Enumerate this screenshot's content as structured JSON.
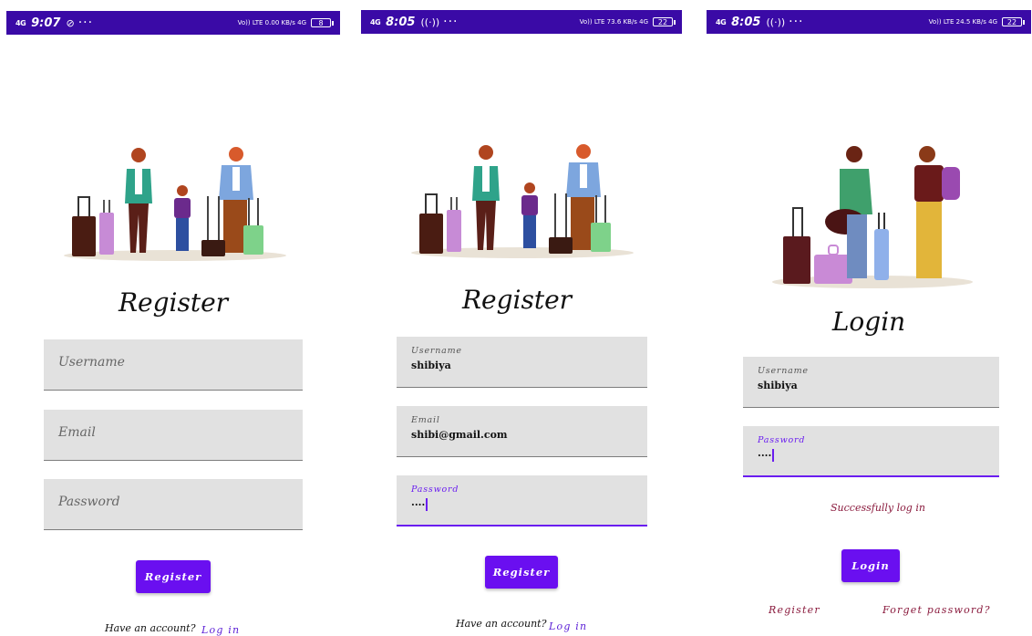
{
  "screens": [
    {
      "status": {
        "signal": "4G",
        "time": "9:07",
        "extra": "⊘",
        "right": "Vo)) LTE  0.00 KB/s  4G",
        "battery": "8"
      },
      "title": "Register",
      "fields": [
        {
          "placeholder": "Username"
        },
        {
          "placeholder": "Email"
        },
        {
          "placeholder": "Password"
        }
      ],
      "button": "Register",
      "footer_text": "Have an account?",
      "footer_link": "Log in"
    },
    {
      "status": {
        "signal": "4G",
        "time": "8:05",
        "extra": "((·))",
        "right": "Vo)) LTE  73.6 KB/s  4G",
        "battery": "22"
      },
      "title": "Register",
      "fields": [
        {
          "label": "Username",
          "value": "shibiya"
        },
        {
          "label": "Email",
          "value": "shibi@gmail.com"
        },
        {
          "label": "Password",
          "value": "····"
        }
      ],
      "button": "Register",
      "footer_text": "Have an account?",
      "footer_link": "Log in"
    },
    {
      "status": {
        "signal": "4G",
        "time": "8:05",
        "extra": "((·))",
        "right": "Vo)) LTE  24.5 KB/s  4G",
        "battery": "22"
      },
      "title": "Login",
      "fields": [
        {
          "label": "Username",
          "value": "shibiya"
        },
        {
          "label": "Password",
          "value": "····"
        }
      ],
      "message": "Successfully log in",
      "button": "Login",
      "link_left": "Register",
      "link_right": "Forget password?"
    }
  ],
  "colors": {
    "statusbar": "#3a0aa6",
    "button": "#6a0ff0",
    "field": "#e1e1e1",
    "accent": "#6a1df0",
    "message": "#8a1a3d"
  }
}
